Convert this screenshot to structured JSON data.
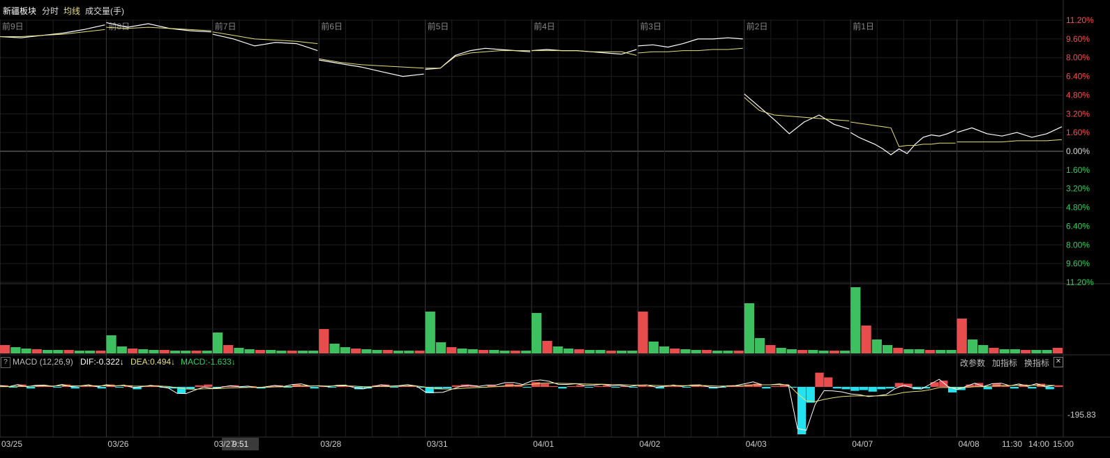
{
  "header": {
    "name": "新疆板块",
    "tab_minute": "分时",
    "tab_avg": "均线",
    "tab_volume": "成交量(手)"
  },
  "colors": {
    "price": "#ffffff",
    "avg": "#e8e07a",
    "up": "#e84d4d",
    "down": "#3fc060",
    "macd_neg": "#24e2f0",
    "grid": "#1e1e1e",
    "axis_red": "#ff4d4d",
    "axis_green": "#2fd15c"
  },
  "chart_data": {
    "type": "line",
    "day_labels": [
      "前9日",
      "前8日",
      "前7日",
      "前6日",
      "前5日",
      "前4日",
      "前3日",
      "前2日",
      "前1日"
    ],
    "x_dates": [
      "03/25",
      "03/26",
      "03/27",
      "03/28",
      "03/31",
      "04/01",
      "04/02",
      "04/03",
      "04/07",
      "04/08"
    ],
    "x_time_labels": [
      "11:30",
      "14:00",
      "15:00"
    ],
    "y_ticks": [
      "11.20%",
      "9.60%",
      "8.00%",
      "6.40%",
      "4.80%",
      "3.20%",
      "1.60%",
      "0.00%",
      "1.60%",
      "3.20%",
      "4.80%",
      "6.40%",
      "8.00%",
      "9.60%",
      "11.20%"
    ],
    "ylim": [
      -11.2,
      11.2
    ],
    "series": [
      {
        "name": "",
        "values": [
          9.8,
          9.7,
          9.9,
          10.1,
          10.4,
          10.8,
          11.0,
          10.6,
          10.9,
          10.5,
          10.3,
          10.2,
          10.0,
          9.6,
          9.0,
          9.3,
          9.2,
          8.6,
          7.8,
          7.5,
          7.2,
          6.8,
          6.4,
          6.6,
          7.0,
          7.1,
          8.2,
          8.6,
          8.8,
          8.7,
          8.6,
          8.5,
          8.6,
          8.7,
          8.6,
          8.6,
          8.5,
          8.4,
          8.3,
          8.7,
          9.0,
          9.1,
          8.9,
          9.2,
          9.6,
          9.6,
          9.7,
          9.6,
          4.9,
          3.8,
          2.7,
          1.5,
          2.5,
          3.1,
          2.3,
          1.9,
          1.6,
          1.2,
          0.9,
          0.6,
          0.2,
          -0.3,
          0.2,
          -0.2,
          0.6,
          1.2,
          1.4,
          1.3,
          1.5,
          1.8,
          1.6,
          2.0,
          1.5,
          1.3,
          1.6,
          1.2,
          1.5,
          2.1
        ]
      },
      {
        "name": "",
        "values": [
          9.8,
          9.8,
          9.9,
          10.0,
          10.2,
          10.4,
          10.6,
          10.5,
          10.6,
          10.5,
          10.4,
          10.3,
          10.2,
          9.9,
          9.6,
          9.5,
          9.4,
          9.2,
          7.9,
          7.6,
          7.4,
          7.3,
          7.2,
          7.1,
          7.1,
          7.1,
          8.1,
          8.4,
          8.5,
          8.6,
          8.6,
          8.6,
          8.6,
          8.6,
          8.6,
          8.6,
          8.5,
          8.5,
          8.5,
          8.2,
          8.4,
          8.5,
          8.5,
          8.6,
          8.6,
          8.7,
          8.7,
          8.8,
          4.6,
          3.5,
          3.1,
          3.0,
          2.9,
          2.8,
          2.7,
          2.6,
          2.5,
          2.4,
          2.3,
          2.2,
          2.1,
          2.0,
          0.4,
          0.5,
          0.5,
          0.6,
          0.6,
          0.7,
          0.7,
          0.7,
          0.8,
          0.8,
          0.8,
          0.8,
          0.9,
          0.9,
          0.9,
          1.0
        ]
      }
    ],
    "volume": {
      "values": [
        12,
        9,
        7,
        6,
        5,
        5,
        5,
        4,
        4,
        4,
        26,
        10,
        7,
        6,
        5,
        5,
        4,
        4,
        4,
        4,
        30,
        12,
        8,
        6,
        5,
        5,
        4,
        4,
        4,
        4,
        35,
        14,
        9,
        7,
        6,
        5,
        5,
        4,
        4,
        4,
        60,
        16,
        9,
        7,
        6,
        5,
        5,
        4,
        4,
        4,
        58,
        18,
        10,
        7,
        6,
        5,
        5,
        4,
        4,
        4,
        60,
        17,
        10,
        7,
        6,
        5,
        5,
        4,
        4,
        4,
        72,
        22,
        12,
        8,
        6,
        5,
        5,
        4,
        4,
        4,
        95,
        40,
        20,
        12,
        8,
        6,
        6,
        5,
        5,
        5,
        50,
        20,
        12,
        8,
        6,
        6,
        5,
        5,
        5,
        8
      ]
    },
    "macd": {
      "label": "MACD (12,26,9)",
      "dif_text": "DIF:-0.322↓",
      "dea_text": "DEA:0.494↓",
      "macd_text": "MACD:-1.633↓",
      "low_label": "-195.83",
      "hist": [
        2,
        -1,
        3,
        -2,
        2,
        1,
        -1,
        3,
        -2,
        1,
        2,
        -2,
        3,
        -1,
        2,
        -3,
        1,
        2,
        -1,
        -2,
        -8,
        -3,
        2,
        3,
        -2,
        1,
        2,
        -1,
        1,
        -2,
        1,
        2,
        -1,
        3,
        2,
        -2,
        1,
        -1,
        2,
        1,
        -3,
        -2,
        2,
        3,
        -1,
        1,
        2,
        -1,
        -8,
        -3,
        -2,
        2,
        3,
        2,
        -1,
        2,
        1,
        4,
        2,
        -1,
        6,
        4,
        1,
        -2,
        1,
        2,
        -1,
        1,
        2,
        -1,
        1,
        -1,
        2,
        1,
        -2,
        1,
        2,
        -1,
        2,
        1,
        -2,
        -1,
        2,
        1,
        3,
        4,
        -2,
        1,
        2,
        -1,
        -60,
        -20,
        18,
        12,
        -2,
        -3,
        -5,
        -4,
        -6,
        -3,
        -2,
        5,
        4,
        -3,
        -2,
        6,
        8,
        -7,
        -4,
        3,
        5,
        -3,
        4,
        2,
        -2,
        3,
        -2,
        4,
        -3,
        2
      ]
    }
  },
  "macd_buttons": {
    "change_params": "改参数",
    "add_indicator": "加指标",
    "switch_indicator": "换指标",
    "close": "✕",
    "help": "?"
  },
  "crosshair_time": "9:51"
}
